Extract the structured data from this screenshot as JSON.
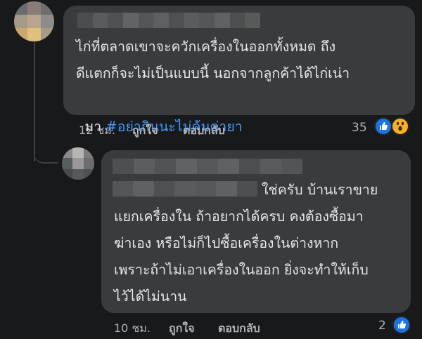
{
  "comment1": {
    "lines": [
      "ไก่ที่ตลาดเขาจะควักเครื่องในออกทั้งหมด ถึง",
      "ดีแตกก็จะไม่เป็นแบบนี้ นอกจากลูกค้าได้ไก่เน่า",
      "มา "
    ],
    "hashtag": "#อย่ากินนะไม่คุ้มค่ายา",
    "time": "12 ชม.",
    "like_label": "ถูกใจ",
    "reply_label": "ตอบกลับ",
    "reaction_count": "35",
    "reactions": [
      "like-icon",
      "wow-icon"
    ]
  },
  "comment2": {
    "first_line": "ใช่ครับ บ้านเราขาย",
    "lines": [
      "แยกเครื่องใน ถ้าอยากได้ครบ คงต้องซื้อมา",
      "ฆ่าเอง หรือไม่ก็ไปซื้อเครื่องในต่างหาก",
      "เพราะถ้าไม่เอาเครื่องในออก ยิ่งจะทำให้เก็บ",
      "ไว้ได้ไม่นาน"
    ],
    "time": "10 ชม.",
    "like_label": "ถูกใจ",
    "reply_label": "ตอบกลับ",
    "reaction_count": "2",
    "reactions": [
      "like-icon"
    ]
  },
  "colors": {
    "background": "#18191a",
    "bubble": "#3a3b3c",
    "text": "#e4e6eb",
    "meta": "#b0b3b8",
    "hashtag": "#4599ff",
    "like": "#1b74e4",
    "wow": "#f7b125"
  }
}
